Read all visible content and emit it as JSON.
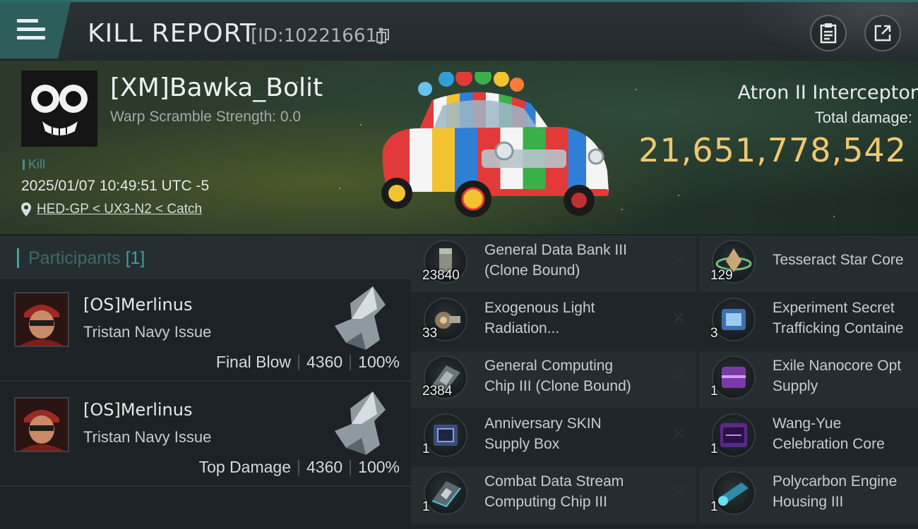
{
  "topbar": {
    "title": "KILL REPORT",
    "kill_id": "[ID:10221661]",
    "icons": [
      "menu-icon",
      "copy-icon",
      "clipboard-icon",
      "share-icon"
    ]
  },
  "victim": {
    "name": "[XM]Bawka_Bolit",
    "warp_scramble": "Warp Scramble Strength: 0.0",
    "kill_tag": "Kill",
    "timestamp": "2025/01/07 10:49:51 UTC -5",
    "location": "HED-GP < UX3-N2 < Catch",
    "ship": "Atron II Interceptor",
    "total_damage_label": "Total damage:",
    "total_damage": "21,651,778,542"
  },
  "participants": {
    "title": "Participants",
    "count": "[1]",
    "rows": [
      {
        "name": "[OS]Merlinus",
        "ship": "Tristan Navy Issue",
        "role": "Final Blow",
        "damage": "4360",
        "percent": "100%"
      },
      {
        "name": "[OS]Merlinus",
        "ship": "Tristan Navy Issue",
        "role": "Top Damage",
        "damage": "4360",
        "percent": "100%"
      }
    ]
  },
  "items": {
    "left": [
      {
        "qty": "23840",
        "line1": "General Data Bank III",
        "line2": "(Clone Bound)",
        "icon": "data-bank-icon"
      },
      {
        "qty": "33",
        "line1": "Exogenous Light",
        "line2": "Radiation...",
        "icon": "radiation-icon"
      },
      {
        "qty": "2384",
        "line1": "General Computing",
        "line2": "Chip III (Clone Bound)",
        "icon": "computing-chip-icon"
      },
      {
        "qty": "1",
        "line1": "Anniversary SKIN",
        "line2": "Supply Box",
        "icon": "supply-box-icon"
      },
      {
        "qty": "1",
        "line1": "Combat Data Stream",
        "line2": "Computing Chip III",
        "icon": "data-chip-icon"
      }
    ],
    "right": [
      {
        "qty": "129",
        "line1": "Tesseract Star Core",
        "line2": "",
        "icon": "star-core-icon"
      },
      {
        "qty": "3",
        "line1": "Experiment Secret",
        "line2": "Trafficking Containe",
        "icon": "container-icon"
      },
      {
        "qty": "1",
        "line1": "Exile Nanocore Opt",
        "line2": "Supply",
        "icon": "nanocore-supply-icon"
      },
      {
        "qty": "1",
        "line1": "Wang-Yue",
        "line2": "Celebration Core",
        "icon": "celebration-core-icon"
      },
      {
        "qty": "1",
        "line1": "Polycarbon Engine",
        "line2": "Housing III",
        "icon": "engine-housing-icon"
      }
    ],
    "remove_glyph": "✕"
  },
  "colors": {
    "accent": "#2e6c6a",
    "damage": "#efc86e",
    "background": "#1b2023"
  }
}
